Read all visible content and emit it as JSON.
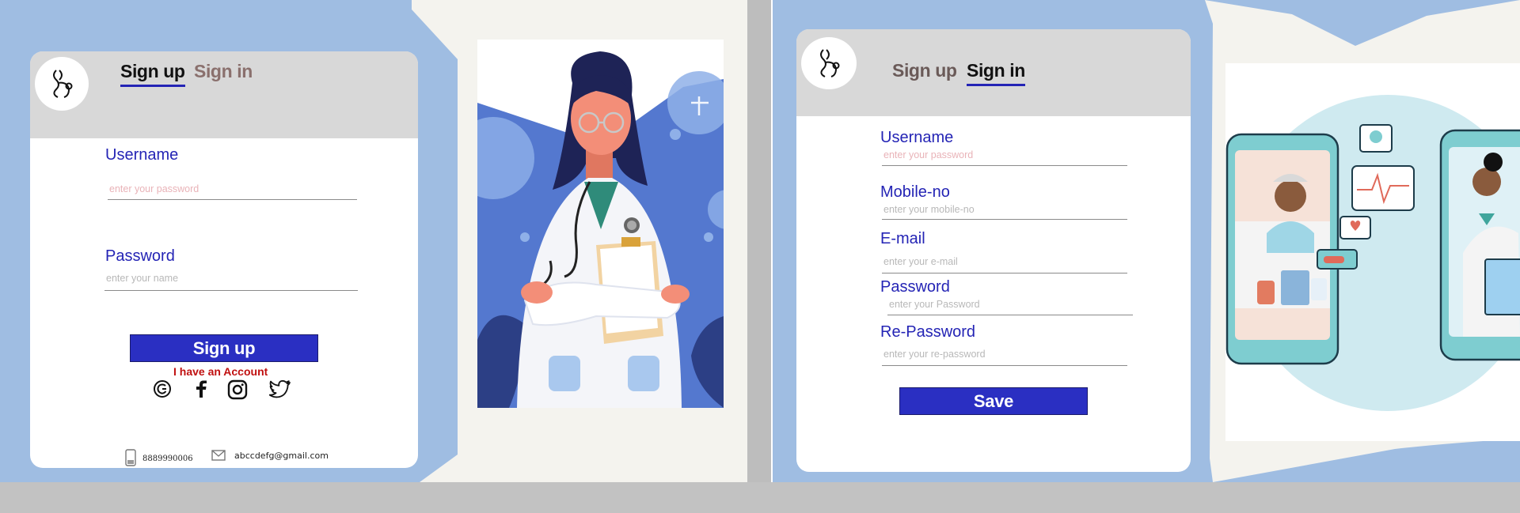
{
  "signup_screen": {
    "tabs": [
      {
        "label": "Sign up",
        "active": true
      },
      {
        "label": "Sign in",
        "active": false
      }
    ],
    "username": {
      "label": "Username",
      "placeholder": "enter your password"
    },
    "password": {
      "label": "Password",
      "placeholder": "enter your name"
    },
    "submit_label": "Sign up",
    "account_link": "I have an Account",
    "social_icons": [
      "google-icon",
      "facebook-icon",
      "instagram-icon",
      "twitter-icon"
    ],
    "footer": {
      "phone": "8889990006",
      "email": "abccdefg@gmail.com"
    },
    "illustration": "doctor-illustration"
  },
  "signin_screen": {
    "tabs": [
      {
        "label": "Sign up",
        "active": false
      },
      {
        "label": "Sign in",
        "active": true
      }
    ],
    "fields": [
      {
        "label": "Username",
        "placeholder": "enter your password"
      },
      {
        "label": "Mobile-no",
        "placeholder": "enter your mobile-no"
      },
      {
        "label": "E-mail",
        "placeholder": "enter your e-mail"
      },
      {
        "label": "Password",
        "placeholder": "enter your Password"
      },
      {
        "label": "Re-Password",
        "placeholder": "enter your re-password"
      }
    ],
    "submit_label": "Save",
    "illustration": "telemedicine-illustration"
  },
  "colors": {
    "page_background": "#9fbde2",
    "accent_blue": "#2424b5",
    "button_blue": "#2a2fc2",
    "link_red": "#c01010",
    "inactive_tab": "#8a706d"
  }
}
